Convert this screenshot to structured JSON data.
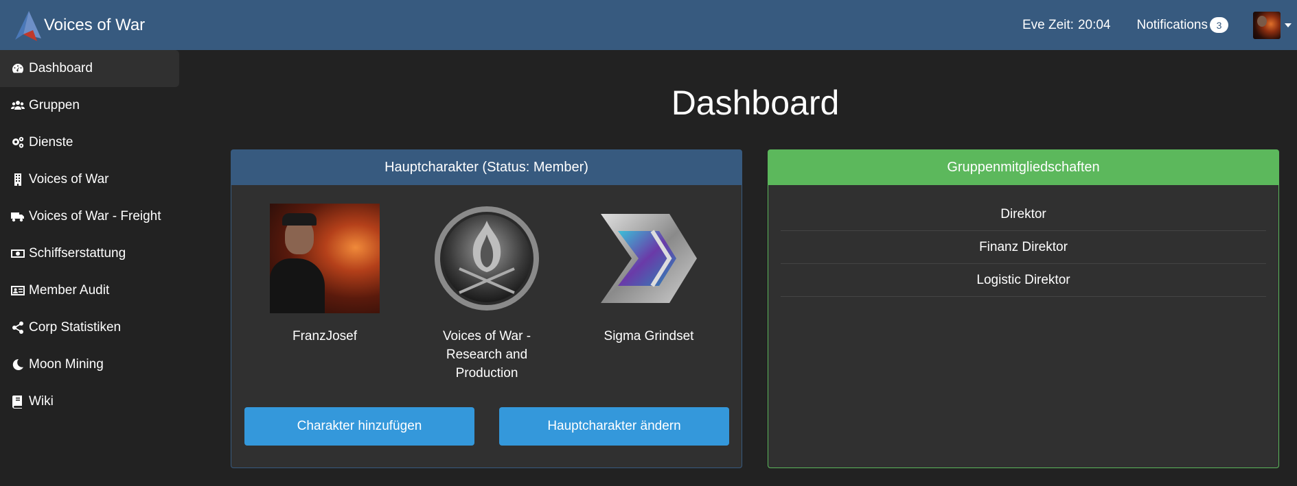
{
  "navbar": {
    "brand": "Voices of War",
    "eve_time_label": "Eve Zeit:",
    "eve_time_value": "20:04",
    "notifications_label": "Notifications",
    "notifications_count": "3"
  },
  "sidebar": {
    "items": [
      {
        "label": "Dashboard",
        "icon": "gauge-icon",
        "active": true
      },
      {
        "label": "Gruppen",
        "icon": "users-icon"
      },
      {
        "label": "Dienste",
        "icon": "cogs-icon"
      },
      {
        "label": "Voices of War",
        "icon": "building-icon"
      },
      {
        "label": "Voices of War - Freight",
        "icon": "truck-icon"
      },
      {
        "label": "Schiffserstattung",
        "icon": "money-bill-icon"
      },
      {
        "label": "Member Audit",
        "icon": "id-card-icon"
      },
      {
        "label": "Corp Statistiken",
        "icon": "share-nodes-icon"
      },
      {
        "label": "Moon Mining",
        "icon": "moon-icon"
      },
      {
        "label": "Wiki",
        "icon": "book-icon"
      }
    ]
  },
  "main": {
    "title": "Dashboard",
    "main_character_card": {
      "header": "Hauptcharakter (Status: Member)",
      "character_name": "FranzJosef",
      "corporation_name": "Voices of War - Research and Production",
      "alliance_name": "Sigma Grindset",
      "add_button": "Charakter hinzufügen",
      "change_button": "Hauptcharakter ändern"
    },
    "groups_card": {
      "header": "Gruppenmitgliedschaften",
      "groups": [
        "Direktor",
        "Finanz Direktor",
        "Logistic Direktor"
      ]
    }
  },
  "colors": {
    "navbar": "#375a7f",
    "background": "#222222",
    "card": "#303030",
    "groups_header": "#5cb85c",
    "button": "#3498db"
  }
}
